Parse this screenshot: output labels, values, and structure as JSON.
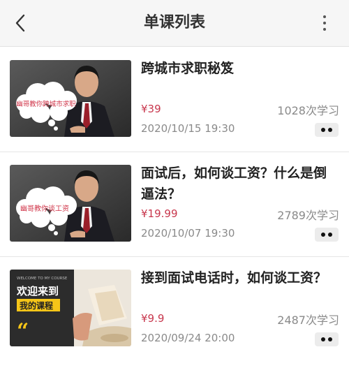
{
  "header": {
    "title": "单课列表",
    "back_icon": "chevron-left-icon",
    "more_icon": "more-vertical-icon"
  },
  "courses": [
    {
      "title": "跨城市求职秘笈",
      "price": "¥39",
      "learners": "1028次学习",
      "date": "2020/10/15 19:30",
      "thumb_text": "幽哥教你跨城市求职"
    },
    {
      "title": "面试后，如何谈工资？什么是倒逼法？",
      "price": "¥19.99",
      "learners": "2789次学习",
      "date": "2020/10/07 19:30",
      "thumb_text": "幽哥教你谈工资"
    },
    {
      "title": "接到面试电话时，如何谈工资？",
      "price": "¥9.9",
      "learners": "2487次学习",
      "date": "2020/09/24 20:00",
      "thumb_small": "WELCOME TO MY COURSE",
      "thumb_line1": "欢迎来到",
      "thumb_line2": "我的课程"
    }
  ],
  "colors": {
    "price": "#c8374d",
    "muted": "#8a8a8a",
    "topbar": "#f6f6f6"
  }
}
